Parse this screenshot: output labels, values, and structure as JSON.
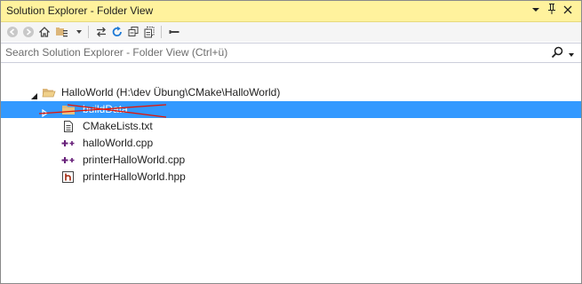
{
  "window": {
    "title": "Solution Explorer - Folder View",
    "menu_glyph": "▾",
    "pin_glyph": "ᵖ",
    "close_glyph": "✕"
  },
  "search": {
    "placeholder": "Search Solution Explorer - Folder View (Ctrl+ü)",
    "value": ""
  },
  "toolbar": {
    "dropdown_glyph": "▾",
    "items": [
      "back-icon",
      "forward-icon",
      "home-icon",
      "switch-views-icon",
      "sync-icon",
      "refresh-icon",
      "collapse-all-icon",
      "show-all-files-icon",
      "properties-icon"
    ]
  },
  "colors": {
    "title_bar": "#fff29d",
    "selection": "#3399ff",
    "folder": "#dcb67a",
    "cpp_icon": "#68217a",
    "header_icon": "#a1260d",
    "strike": "#e51400"
  },
  "tree": {
    "root": {
      "label": "HalloWorld (H:\\dev Übung\\CMake\\HalloWorld)",
      "expanded": true
    },
    "items": [
      {
        "label": "buildData",
        "type": "folder",
        "selected": true,
        "expanded": false
      },
      {
        "label": "CMakeLists.txt",
        "type": "text-file"
      },
      {
        "label": "halloWorld.cpp",
        "type": "cpp-file"
      },
      {
        "label": "printerHalloWorld.cpp",
        "type": "cpp-file"
      },
      {
        "label": "printerHalloWorld.hpp",
        "type": "header-file"
      }
    ]
  }
}
